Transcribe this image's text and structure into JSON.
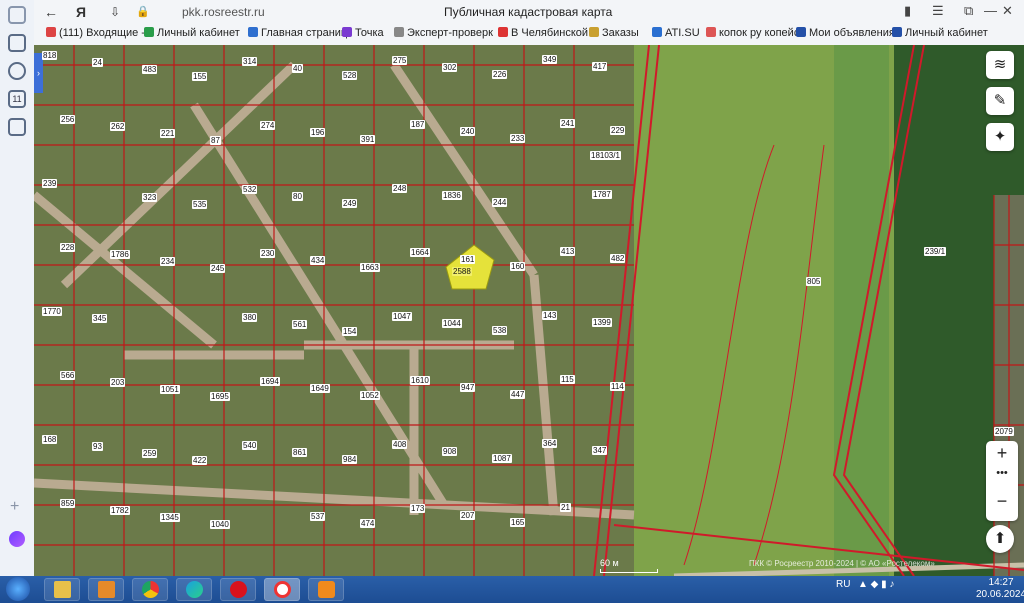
{
  "browser": {
    "url": "pkk.rosreestr.ru",
    "page_title": "Публичная кадастровая карта"
  },
  "bookmarks": [
    {
      "label": "(111) Входящие -",
      "color": "#d44"
    },
    {
      "label": "Личный кабинет",
      "color": "#2a9d4a"
    },
    {
      "label": "Главная страниц",
      "color": "#2f6fcf"
    },
    {
      "label": "Точка",
      "color": "#7a3ad1"
    },
    {
      "label": "Эксперт-проверк",
      "color": "#888"
    },
    {
      "label": "В Челябинской о",
      "color": "#d33"
    },
    {
      "label": "Заказы",
      "color": "#c9a030"
    },
    {
      "label": "ATI.SU",
      "color": "#2a6fd1"
    },
    {
      "label": "копок ру копейск",
      "color": "#d55"
    },
    {
      "label": "Мои объявления",
      "color": "#2450a8"
    },
    {
      "label": "Личный кабинет",
      "color": "#2450a8"
    }
  ],
  "map": {
    "plot_labels": [
      "818",
      "24",
      "483",
      "155",
      "314",
      "40",
      "528",
      "275",
      "302",
      "226",
      "349",
      "417",
      "256",
      "262",
      "221",
      "87",
      "274",
      "196",
      "391",
      "187",
      "240",
      "233",
      "241",
      "229",
      "239",
      "18103/1",
      "323",
      "535",
      "532",
      "80",
      "249",
      "248",
      "1836",
      "244",
      "2588",
      "1787",
      "228",
      "1786",
      "234",
      "245",
      "230",
      "434",
      "1663",
      "1664",
      "161",
      "160",
      "413",
      "482",
      "1770",
      "345",
      "805",
      "239/1",
      "380",
      "561",
      "154",
      "1047",
      "1044",
      "538",
      "143",
      "1399",
      "566",
      "203",
      "1051",
      "1695",
      "1694",
      "1649",
      "1052",
      "1610",
      "947",
      "447",
      "115",
      "114",
      "168",
      "93",
      "259",
      "422",
      "540",
      "861",
      "984",
      "408",
      "908",
      "1087",
      "364",
      "347",
      "859",
      "1782",
      "1345",
      "1040",
      "2079",
      "537",
      "474",
      "173",
      "207",
      "165",
      "21"
    ],
    "highlighted_plot": "2588",
    "scale_label": "60 м",
    "attribution": "ПКК © Росреестр 2010-2024 | © АО «Ростелеком»"
  },
  "map_controls": {
    "layers_icon": "layers-icon",
    "ruler_icon": "ruler-icon",
    "locate_icon": "crosshair-icon",
    "zoom_in": "+",
    "zoom_more": "•••",
    "zoom_out": "−"
  },
  "taskbar": {
    "lang": "RU",
    "time": "14:27",
    "date": "20.06.2024"
  }
}
